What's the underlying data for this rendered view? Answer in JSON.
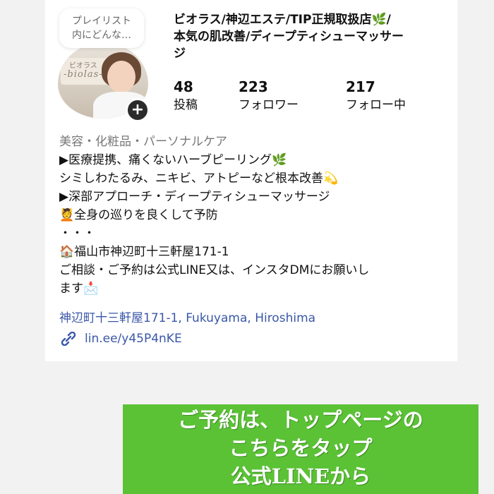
{
  "profile": {
    "note": [
      "プレイリスト",
      "内にどんな…"
    ],
    "avatar_sign_small": "ビオラス",
    "avatar_sign_big": "-biolas-",
    "add_symbol": "+",
    "name_line1": "ビオラス/神辺エステ/TIP正規取扱店🌿/",
    "name_line2": "本気の肌改善/ディープティシューマッサー",
    "name_line3": "ジ"
  },
  "stats": [
    {
      "value": "48",
      "label": "投稿"
    },
    {
      "value": "223",
      "label": "フォロワー"
    },
    {
      "value": "217",
      "label": "フォロー中"
    }
  ],
  "bio": {
    "category": "美容・化粧品・パーソナルケア",
    "lines": [
      "▶医療提携、痛くないハーブピーリング🌿",
      "シミしわたるみ、ニキビ、アトピーなど根本改善💫",
      "▶深部アプローチ・ディープティシューマッサージ",
      "💆全身の巡りを良くして予防",
      "・・・",
      "🏠福山市神辺町十三軒屋171-1",
      "ご相談・ご予約は公式LINE又は、インスタDMにお願いし",
      "ます📩"
    ]
  },
  "location": "神辺町十三軒屋171-1, Fukuyama, Hiroshima",
  "link": "lin.ee/y45P4nKE",
  "cta": {
    "lines": [
      "ご予約は、トップページの",
      "こちらをタップ",
      "公式LINEから"
    ],
    "color": "#5bc236"
  }
}
